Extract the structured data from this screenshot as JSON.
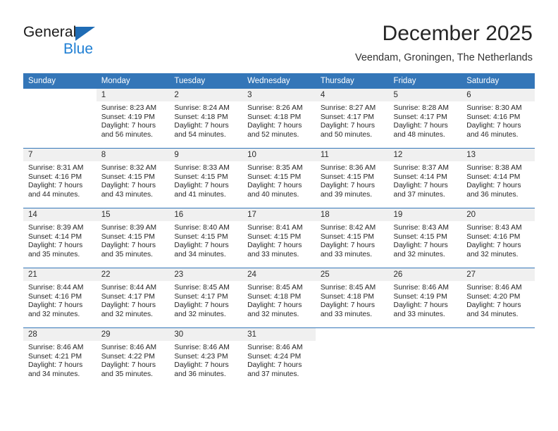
{
  "brand": {
    "line1": "General",
    "line2": "Blue",
    "flag_icon": "triangle-flag-icon",
    "accent_color": "#1f7fd4"
  },
  "header": {
    "title": "December 2025",
    "subtitle": "Veendam, Groningen, The Netherlands"
  },
  "theme": {
    "header_blue": "#3476b8",
    "daynum_band": "#f0f0f0",
    "text": "#262626"
  },
  "calendar": {
    "weekday_headers": [
      "Sunday",
      "Monday",
      "Tuesday",
      "Wednesday",
      "Thursday",
      "Friday",
      "Saturday"
    ],
    "labels": {
      "sunrise": "Sunrise:",
      "sunset": "Sunset:",
      "daylight": "Daylight:"
    },
    "weeks": [
      [
        {
          "day": "",
          "blank": true,
          "sunrise": "",
          "sunset": "",
          "daylight_1": "",
          "daylight_2": ""
        },
        {
          "day": "1",
          "sunrise": "Sunrise: 8:23 AM",
          "sunset": "Sunset: 4:19 PM",
          "daylight_1": "Daylight: 7 hours",
          "daylight_2": "and 56 minutes."
        },
        {
          "day": "2",
          "sunrise": "Sunrise: 8:24 AM",
          "sunset": "Sunset: 4:18 PM",
          "daylight_1": "Daylight: 7 hours",
          "daylight_2": "and 54 minutes."
        },
        {
          "day": "3",
          "sunrise": "Sunrise: 8:26 AM",
          "sunset": "Sunset: 4:18 PM",
          "daylight_1": "Daylight: 7 hours",
          "daylight_2": "and 52 minutes."
        },
        {
          "day": "4",
          "sunrise": "Sunrise: 8:27 AM",
          "sunset": "Sunset: 4:17 PM",
          "daylight_1": "Daylight: 7 hours",
          "daylight_2": "and 50 minutes."
        },
        {
          "day": "5",
          "sunrise": "Sunrise: 8:28 AM",
          "sunset": "Sunset: 4:17 PM",
          "daylight_1": "Daylight: 7 hours",
          "daylight_2": "and 48 minutes."
        },
        {
          "day": "6",
          "sunrise": "Sunrise: 8:30 AM",
          "sunset": "Sunset: 4:16 PM",
          "daylight_1": "Daylight: 7 hours",
          "daylight_2": "and 46 minutes."
        }
      ],
      [
        {
          "day": "7",
          "sunrise": "Sunrise: 8:31 AM",
          "sunset": "Sunset: 4:16 PM",
          "daylight_1": "Daylight: 7 hours",
          "daylight_2": "and 44 minutes."
        },
        {
          "day": "8",
          "sunrise": "Sunrise: 8:32 AM",
          "sunset": "Sunset: 4:15 PM",
          "daylight_1": "Daylight: 7 hours",
          "daylight_2": "and 43 minutes."
        },
        {
          "day": "9",
          "sunrise": "Sunrise: 8:33 AM",
          "sunset": "Sunset: 4:15 PM",
          "daylight_1": "Daylight: 7 hours",
          "daylight_2": "and 41 minutes."
        },
        {
          "day": "10",
          "sunrise": "Sunrise: 8:35 AM",
          "sunset": "Sunset: 4:15 PM",
          "daylight_1": "Daylight: 7 hours",
          "daylight_2": "and 40 minutes."
        },
        {
          "day": "11",
          "sunrise": "Sunrise: 8:36 AM",
          "sunset": "Sunset: 4:15 PM",
          "daylight_1": "Daylight: 7 hours",
          "daylight_2": "and 39 minutes."
        },
        {
          "day": "12",
          "sunrise": "Sunrise: 8:37 AM",
          "sunset": "Sunset: 4:14 PM",
          "daylight_1": "Daylight: 7 hours",
          "daylight_2": "and 37 minutes."
        },
        {
          "day": "13",
          "sunrise": "Sunrise: 8:38 AM",
          "sunset": "Sunset: 4:14 PM",
          "daylight_1": "Daylight: 7 hours",
          "daylight_2": "and 36 minutes."
        }
      ],
      [
        {
          "day": "14",
          "sunrise": "Sunrise: 8:39 AM",
          "sunset": "Sunset: 4:14 PM",
          "daylight_1": "Daylight: 7 hours",
          "daylight_2": "and 35 minutes."
        },
        {
          "day": "15",
          "sunrise": "Sunrise: 8:39 AM",
          "sunset": "Sunset: 4:15 PM",
          "daylight_1": "Daylight: 7 hours",
          "daylight_2": "and 35 minutes."
        },
        {
          "day": "16",
          "sunrise": "Sunrise: 8:40 AM",
          "sunset": "Sunset: 4:15 PM",
          "daylight_1": "Daylight: 7 hours",
          "daylight_2": "and 34 minutes."
        },
        {
          "day": "17",
          "sunrise": "Sunrise: 8:41 AM",
          "sunset": "Sunset: 4:15 PM",
          "daylight_1": "Daylight: 7 hours",
          "daylight_2": "and 33 minutes."
        },
        {
          "day": "18",
          "sunrise": "Sunrise: 8:42 AM",
          "sunset": "Sunset: 4:15 PM",
          "daylight_1": "Daylight: 7 hours",
          "daylight_2": "and 33 minutes."
        },
        {
          "day": "19",
          "sunrise": "Sunrise: 8:43 AM",
          "sunset": "Sunset: 4:15 PM",
          "daylight_1": "Daylight: 7 hours",
          "daylight_2": "and 32 minutes."
        },
        {
          "day": "20",
          "sunrise": "Sunrise: 8:43 AM",
          "sunset": "Sunset: 4:16 PM",
          "daylight_1": "Daylight: 7 hours",
          "daylight_2": "and 32 minutes."
        }
      ],
      [
        {
          "day": "21",
          "sunrise": "Sunrise: 8:44 AM",
          "sunset": "Sunset: 4:16 PM",
          "daylight_1": "Daylight: 7 hours",
          "daylight_2": "and 32 minutes."
        },
        {
          "day": "22",
          "sunrise": "Sunrise: 8:44 AM",
          "sunset": "Sunset: 4:17 PM",
          "daylight_1": "Daylight: 7 hours",
          "daylight_2": "and 32 minutes."
        },
        {
          "day": "23",
          "sunrise": "Sunrise: 8:45 AM",
          "sunset": "Sunset: 4:17 PM",
          "daylight_1": "Daylight: 7 hours",
          "daylight_2": "and 32 minutes."
        },
        {
          "day": "24",
          "sunrise": "Sunrise: 8:45 AM",
          "sunset": "Sunset: 4:18 PM",
          "daylight_1": "Daylight: 7 hours",
          "daylight_2": "and 32 minutes."
        },
        {
          "day": "25",
          "sunrise": "Sunrise: 8:45 AM",
          "sunset": "Sunset: 4:18 PM",
          "daylight_1": "Daylight: 7 hours",
          "daylight_2": "and 33 minutes."
        },
        {
          "day": "26",
          "sunrise": "Sunrise: 8:46 AM",
          "sunset": "Sunset: 4:19 PM",
          "daylight_1": "Daylight: 7 hours",
          "daylight_2": "and 33 minutes."
        },
        {
          "day": "27",
          "sunrise": "Sunrise: 8:46 AM",
          "sunset": "Sunset: 4:20 PM",
          "daylight_1": "Daylight: 7 hours",
          "daylight_2": "and 34 minutes."
        }
      ],
      [
        {
          "day": "28",
          "sunrise": "Sunrise: 8:46 AM",
          "sunset": "Sunset: 4:21 PM",
          "daylight_1": "Daylight: 7 hours",
          "daylight_2": "and 34 minutes."
        },
        {
          "day": "29",
          "sunrise": "Sunrise: 8:46 AM",
          "sunset": "Sunset: 4:22 PM",
          "daylight_1": "Daylight: 7 hours",
          "daylight_2": "and 35 minutes."
        },
        {
          "day": "30",
          "sunrise": "Sunrise: 8:46 AM",
          "sunset": "Sunset: 4:23 PM",
          "daylight_1": "Daylight: 7 hours",
          "daylight_2": "and 36 minutes."
        },
        {
          "day": "31",
          "sunrise": "Sunrise: 8:46 AM",
          "sunset": "Sunset: 4:24 PM",
          "daylight_1": "Daylight: 7 hours",
          "daylight_2": "and 37 minutes."
        },
        {
          "day": "",
          "blank": true,
          "sunrise": "",
          "sunset": "",
          "daylight_1": "",
          "daylight_2": ""
        },
        {
          "day": "",
          "blank": true,
          "sunrise": "",
          "sunset": "",
          "daylight_1": "",
          "daylight_2": ""
        },
        {
          "day": "",
          "blank": true,
          "sunrise": "",
          "sunset": "",
          "daylight_1": "",
          "daylight_2": ""
        }
      ]
    ]
  }
}
